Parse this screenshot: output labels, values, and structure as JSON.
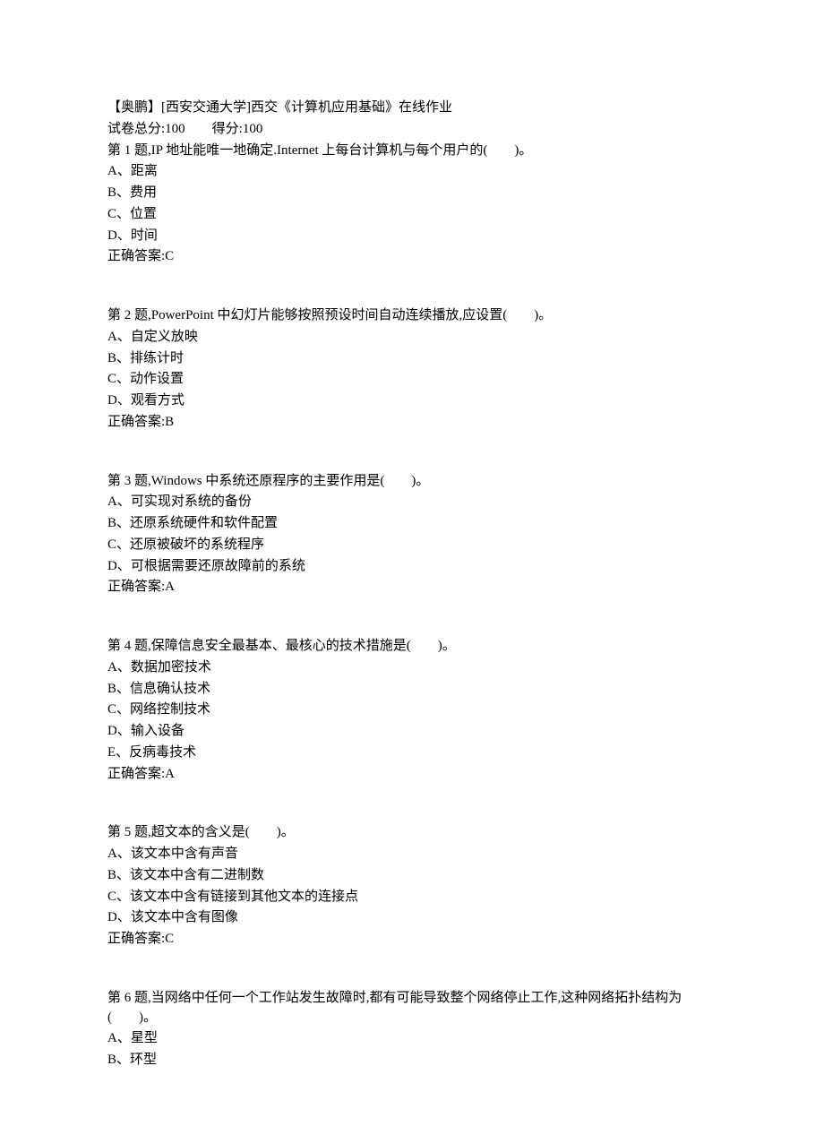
{
  "header": {
    "title": "【奥鹏】[西安交通大学]西交《计算机应用基础》在线作业",
    "score_total_label": "试卷总分:100",
    "score_get_label": "得分:100"
  },
  "questions": [
    {
      "prompt": "第 1 题,IP 地址能唯一地确定.Internet 上每台计算机与每个用户的(　　)。",
      "options": [
        "A、距离",
        "B、费用",
        "C、位置",
        "D、时间"
      ],
      "answer": "正确答案:C"
    },
    {
      "prompt": "第 2 题,PowerPoint 中幻灯片能够按照预设时间自动连续播放,应设置(　　)。",
      "options": [
        "A、自定义放映",
        "B、排练计时",
        "C、动作设置",
        "D、观看方式"
      ],
      "answer": "正确答案:B"
    },
    {
      "prompt": "第 3 题,Windows 中系统还原程序的主要作用是(　　)。",
      "options": [
        "A、可实现对系统的备份",
        "B、还原系统硬件和软件配置",
        "C、还原被破坏的系统程序",
        "D、可根据需要还原故障前的系统"
      ],
      "answer": "正确答案:A"
    },
    {
      "prompt": "第 4 题,保障信息安全最基本、最核心的技术措施是(　　)。",
      "options": [
        "A、数据加密技术",
        "B、信息确认技术",
        "C、网络控制技术",
        "D、输入设备",
        "E、反病毒技术"
      ],
      "answer": "正确答案:A"
    },
    {
      "prompt": "第 5 题,超文本的含义是(　　)。",
      "options": [
        "A、该文本中含有声音",
        "B、该文本中含有二进制数",
        "C、该文本中含有链接到其他文本的连接点",
        "D、该文本中含有图像"
      ],
      "answer": "正确答案:C"
    },
    {
      "prompt": "第 6 题,当网络中任何一个工作站发生故障时,都有可能导致整个网络停止工作,这种网络拓扑结构为(　　)。",
      "options": [
        "A、星型",
        "B、环型"
      ],
      "answer": ""
    }
  ]
}
